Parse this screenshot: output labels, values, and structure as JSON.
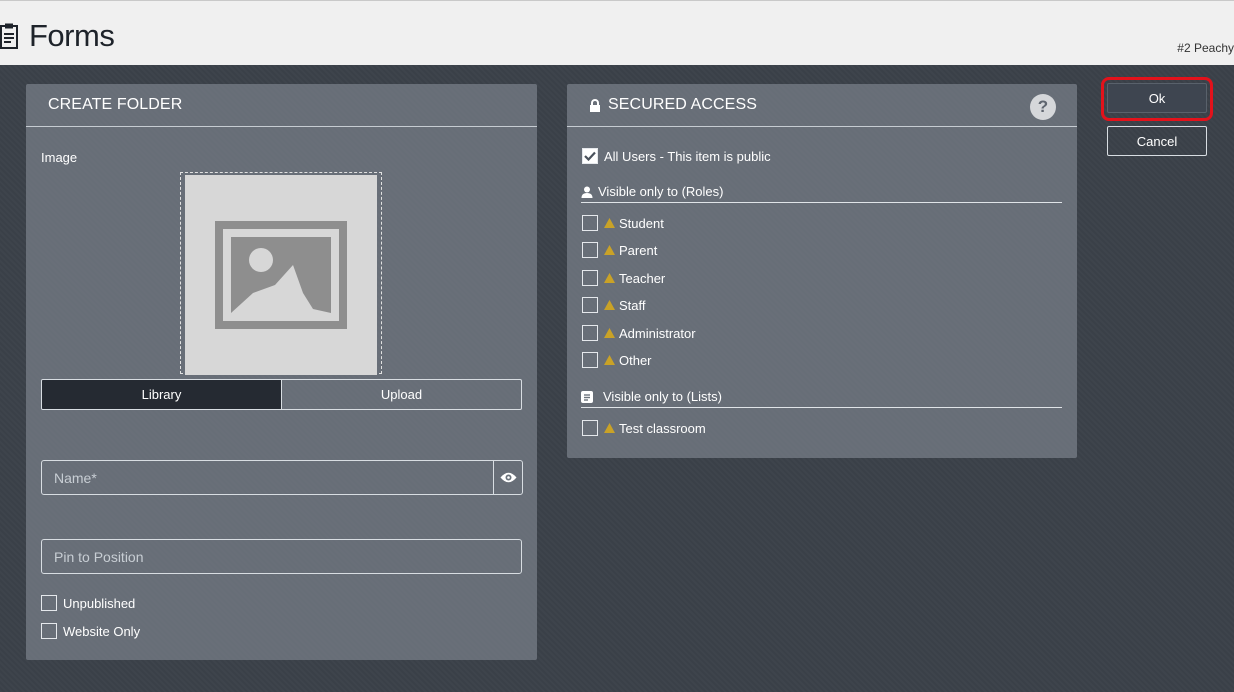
{
  "header": {
    "title": "Forms",
    "user_tag": "#2 Peachy"
  },
  "create_folder": {
    "title": "CREATE FOLDER",
    "image_label": "Image",
    "tabs": [
      "Library",
      "Upload"
    ],
    "active_tab": "Library",
    "name_placeholder": "Name*",
    "pin_placeholder": "Pin to Position",
    "checkboxes": [
      {
        "label": "Unpublished",
        "checked": false
      },
      {
        "label": "Website Only",
        "checked": false
      }
    ]
  },
  "secured_access": {
    "title": "SECURED ACCESS",
    "help_label": "?",
    "all_users": {
      "label": "All Users - This item is public",
      "checked": true
    },
    "roles_title": "Visible only to (Roles)",
    "roles": [
      "Student",
      "Parent",
      "Teacher",
      "Staff",
      "Administrator",
      "Other"
    ],
    "lists_title": "Visible only to (Lists)",
    "lists": [
      "Test classroom"
    ]
  },
  "actions": {
    "ok_label": "Ok",
    "cancel_label": "Cancel"
  },
  "colors": {
    "highlight": "#e3121b",
    "warning": "#c9a227",
    "active_tab": "#252a32"
  },
  "icons": {
    "header": "clipboard-icon",
    "secured": "lock-icon",
    "roles": "user-icon",
    "lists": "list-icon",
    "name": "eye-icon",
    "warning": "warning-icon"
  }
}
